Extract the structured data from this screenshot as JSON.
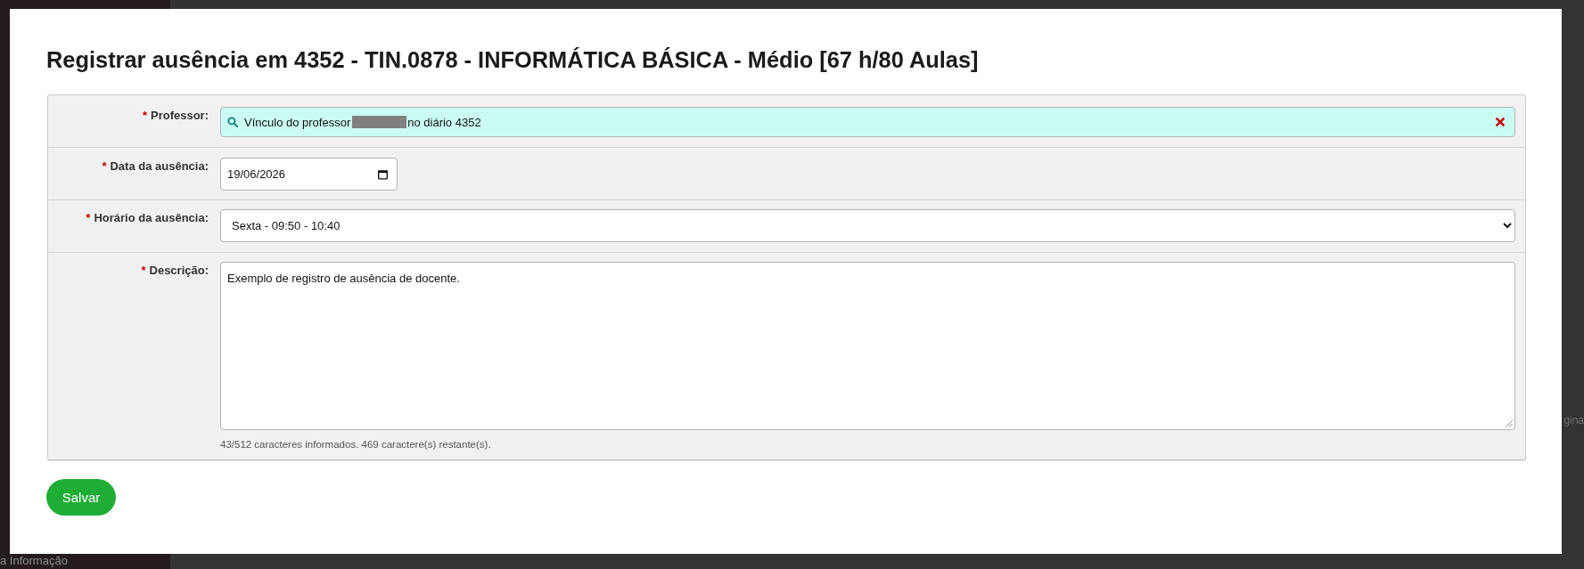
{
  "backdrop": {
    "sidebar_item": "a Informação",
    "page_text": "gina"
  },
  "dialog": {
    "title": "Registrar ausência em 4352 - TIN.0878 - INFORMÁTICA BÁSICA - Médio [67 h/80 Aulas]",
    "fields": [
      {
        "kind": "lookup",
        "required_mark": "*",
        "label": "Professor:",
        "value_parts": [
          {
            "kind": "text",
            "text": "Vínculo do professor"
          },
          {
            "kind": "redacted"
          },
          {
            "kind": "text",
            "text": "no diário 4352"
          }
        ]
      },
      {
        "kind": "date",
        "required_mark": "*",
        "label": "Data da ausência:",
        "value": "19/06/2026"
      },
      {
        "kind": "select",
        "required_mark": "*",
        "label": "Horário da ausência:",
        "value": "Sexta - 09:50 - 10:40"
      },
      {
        "kind": "textarea",
        "required_mark": "*",
        "label": "Descrição:",
        "value": "Exemplo de registro de ausência de docente.",
        "counter": "43/512 caracteres informados. 469 caractere(s) restante(s)."
      }
    ],
    "buttons": [
      {
        "label": "Salvar",
        "kind": "primary"
      }
    ]
  }
}
